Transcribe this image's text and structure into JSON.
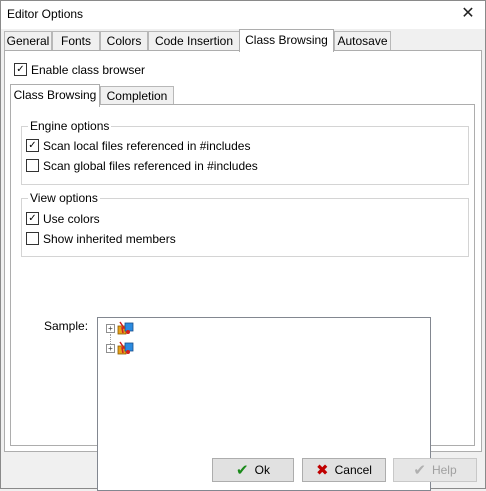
{
  "window": {
    "title": "Editor Options",
    "close_glyph": "✕"
  },
  "tabs": [
    {
      "label": "General"
    },
    {
      "label": "Fonts"
    },
    {
      "label": "Colors"
    },
    {
      "label": "Code Insertion"
    },
    {
      "label": "Class Browsing",
      "active": true
    },
    {
      "label": "Autosave"
    }
  ],
  "enable_class_browser": {
    "label": "Enable class browser",
    "checked": true
  },
  "inner_tabs": [
    {
      "label": "Class Browsing",
      "active": true
    },
    {
      "label": "Completion"
    }
  ],
  "engine_options": {
    "title": "Engine options",
    "scan_local": {
      "label": "Scan local files referenced in #includes",
      "checked": true
    },
    "scan_global": {
      "label": "Scan global files referenced in #includes",
      "checked": false
    }
  },
  "view_options": {
    "title": "View options",
    "use_colors": {
      "label": "Use colors",
      "checked": true
    },
    "show_inherited": {
      "label": "Show inherited members",
      "checked": false
    }
  },
  "sample": {
    "label": "Sample:",
    "tree_items": [
      {
        "icon": "class-icon",
        "expander": "+"
      },
      {
        "icon": "class-icon",
        "expander": "+"
      }
    ]
  },
  "buttons": {
    "ok": {
      "label": "Ok",
      "icon": "check-icon",
      "color": "#1a8a1a"
    },
    "cancel": {
      "label": "Cancel",
      "icon": "x-icon",
      "color": "#c00000"
    },
    "help": {
      "label": "Help",
      "icon": "check-icon",
      "enabled": false
    }
  }
}
